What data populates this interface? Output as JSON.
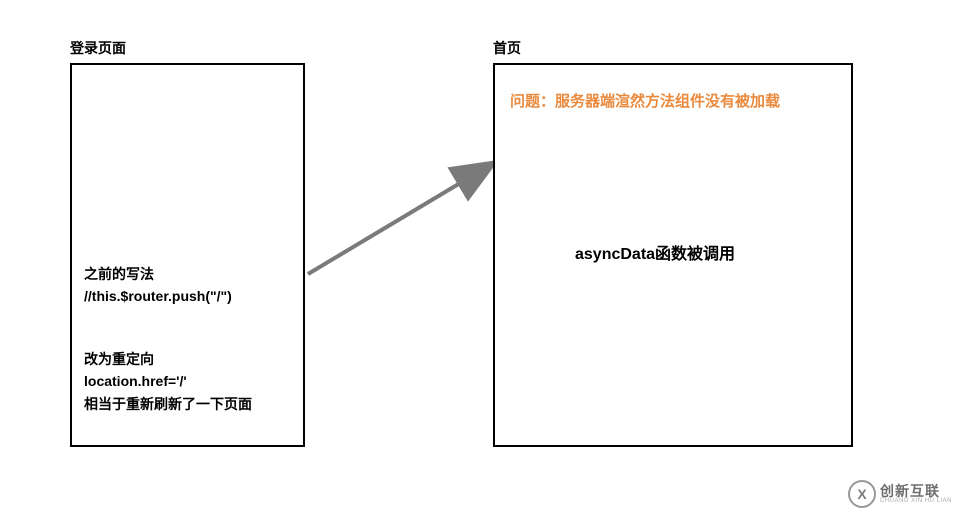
{
  "left_box": {
    "title": "登录页面",
    "previous": {
      "label": "之前的写法",
      "code": "//this.$router.push(\"/\")"
    },
    "redirect": {
      "label": "改为重定向",
      "code": "location.href='/'",
      "note": "相当于重新刷新了一下页面"
    }
  },
  "right_box": {
    "title": "首页",
    "problem": "问题：服务器端渲然方法组件没有被加载",
    "async_note": "asyncData函数被调用"
  },
  "watermark": {
    "main": "创新互联",
    "sub": "CHUANG XIN HU LIAN"
  }
}
